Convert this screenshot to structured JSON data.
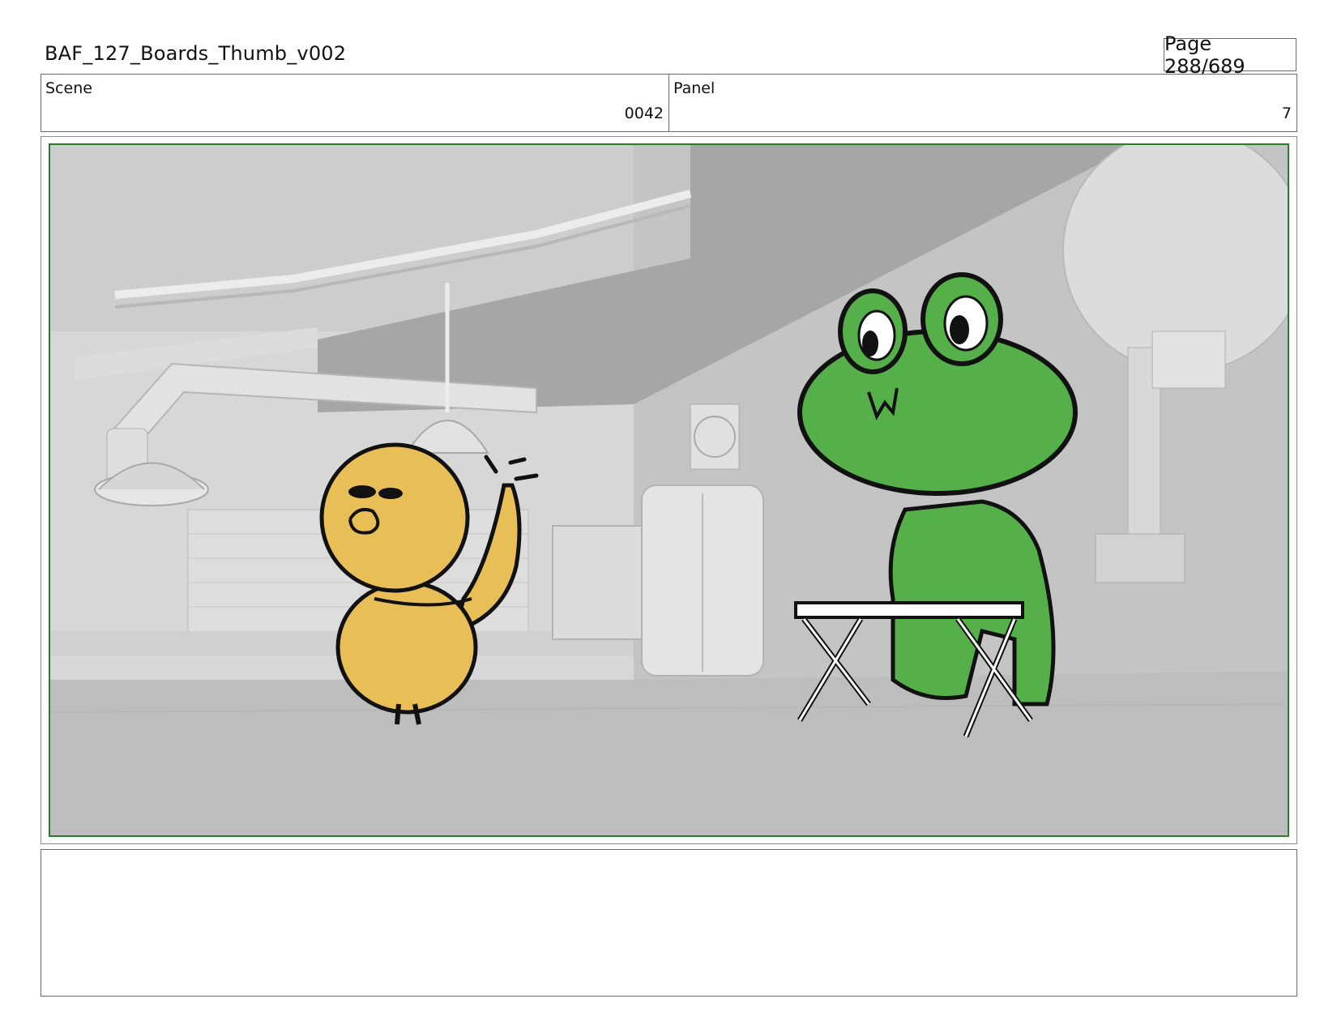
{
  "document": {
    "title": "BAF_127_Boards_Thumb_v002",
    "page": "Page 288/689"
  },
  "info": {
    "scene": {
      "label": "Scene",
      "value": "0042"
    },
    "panel": {
      "label": "Panel",
      "value": "7"
    }
  },
  "colors": {
    "frame_border": "#2c7a2c",
    "duck": "#e8bf57",
    "frog": "#56b04a",
    "background": "#c9c9c9"
  },
  "notes": {
    "text": ""
  }
}
